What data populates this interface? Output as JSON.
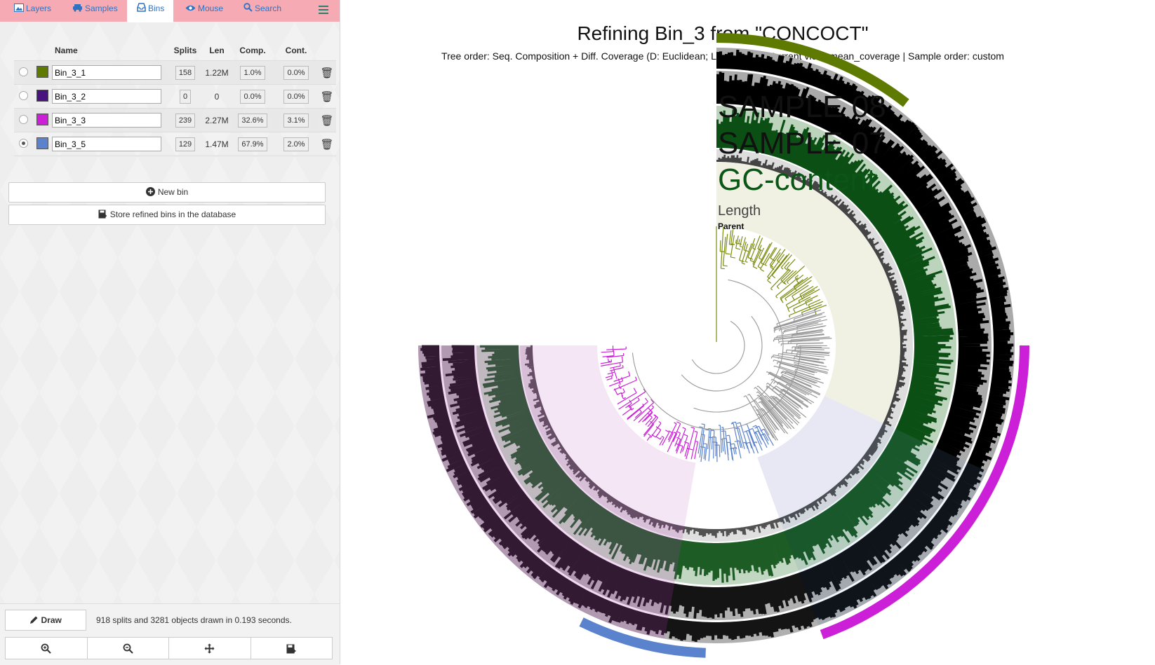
{
  "tabs": [
    {
      "label": "Layers"
    },
    {
      "label": "Samples"
    },
    {
      "label": "Bins"
    },
    {
      "label": "Mouse"
    },
    {
      "label": "Search"
    }
  ],
  "table": {
    "headers": {
      "name": "Name",
      "splits": "Splits",
      "len": "Len",
      "comp": "Comp.",
      "cont": "Cont."
    },
    "rows": [
      {
        "name": "Bin_3_1",
        "color": "#5f7a00",
        "splits": "158",
        "len": "1.22M",
        "comp": "1.0%",
        "cont": "0.0%",
        "selected": false
      },
      {
        "name": "Bin_3_2",
        "color": "#4a1480",
        "splits": "0",
        "len": "0",
        "comp": "0.0%",
        "cont": "0.0%",
        "selected": false
      },
      {
        "name": "Bin_3_3",
        "color": "#cc1fd8",
        "splits": "239",
        "len": "2.27M",
        "comp": "32.6%",
        "cont": "3.1%",
        "selected": false
      },
      {
        "name": "Bin_3_5",
        "color": "#5b82cc",
        "splits": "129",
        "len": "1.47M",
        "comp": "67.9%",
        "cont": "2.0%",
        "selected": true
      }
    ]
  },
  "buttons": {
    "new_bin": "New bin",
    "store": "Store refined bins in the database",
    "draw": "Draw"
  },
  "status": "918 splits and 3281 objects drawn in 0.193 seconds.",
  "main": {
    "title": "Refining Bin_3 from \"CONCOCT\"",
    "subtitle": "Tree order: Seq. Composition + Diff. Coverage (D: Euclidean; L: Average) | Current view: mean_coverage | Sample order: custom"
  },
  "legend": {
    "sample08": "SAMPLE 08",
    "sample07": "SAMPLE 07",
    "gc": "GC-content",
    "length": "Length",
    "parent": "Parent"
  },
  "colors": {
    "tabbar": "#f6aab3",
    "tab_text": "#2f73c0",
    "gc_green": "#0b5516",
    "bin_green": "#5f7a00",
    "bin_magenta": "#cc1fd8",
    "bin_blue": "#5b82cc"
  }
}
